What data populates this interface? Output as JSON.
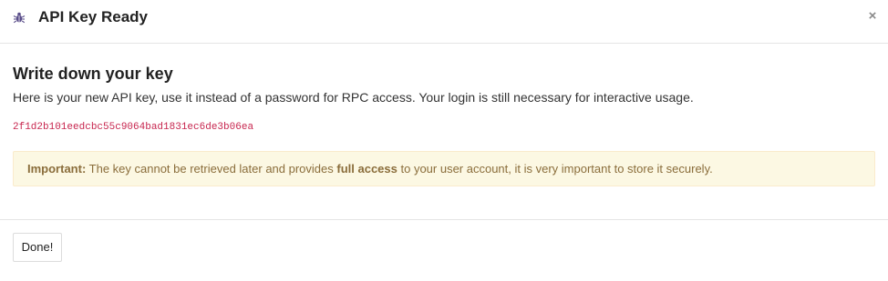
{
  "dialog": {
    "title": "API Key Ready",
    "close_label": "×",
    "header_icon": "bug-icon"
  },
  "body": {
    "heading": "Write down your key",
    "description": "Here is your new API key, use it instead of a password for RPC access. Your login is still necessary for interactive usage.",
    "api_key": "2f1d2b101eedcbc55c9064bad1831ec6de3b06ea",
    "alert": {
      "label": "Important:",
      "text_before": " The key cannot be retrieved later and provides ",
      "emphasis": "full access",
      "text_after": " to your user account, it is very important to store it securely."
    }
  },
  "footer": {
    "done_label": "Done!"
  },
  "colors": {
    "key_text": "#c7254e",
    "alert_bg": "#fcf8e3",
    "alert_border": "#faebcc",
    "alert_text": "#8a6d3b",
    "icon": "#5a4e8a"
  }
}
